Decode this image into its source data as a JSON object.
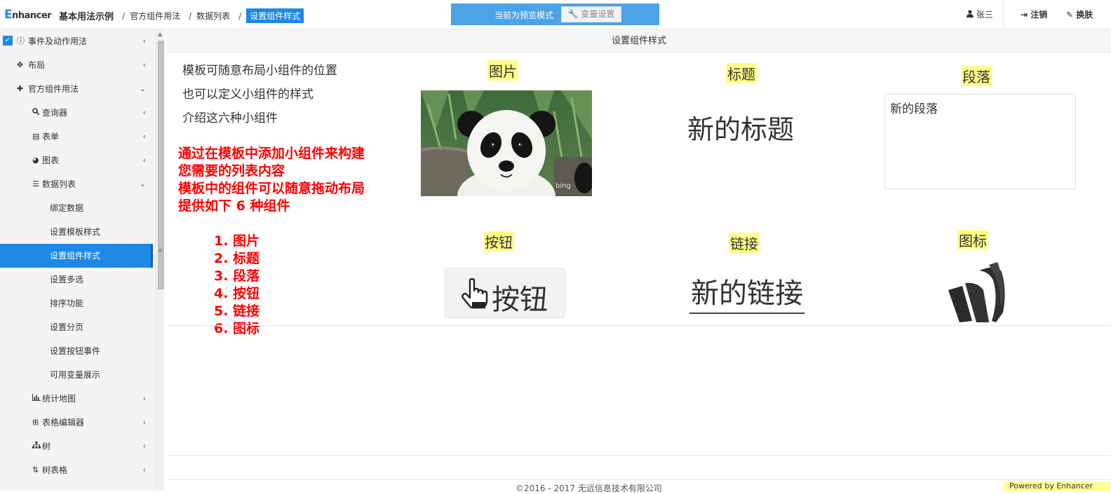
{
  "header": {
    "logo_initial": "E",
    "logo_rest": "nhancer",
    "breadcrumb": [
      "基本用法示例",
      "官方组件用法",
      "数据列表",
      "设置组件样式"
    ],
    "preview_text": "当前为预览模式",
    "variable_button": "变量设置",
    "user_name": "张三",
    "logout": "注销",
    "skin": "换肤"
  },
  "sidebar": {
    "items": [
      {
        "label": "事件及动作用法",
        "icon": "info-circle-icon",
        "arrow": "‹"
      },
      {
        "label": "布局",
        "icon": "move-icon",
        "arrow": "‹"
      },
      {
        "label": "官方组件用法",
        "icon": "puzzle-icon",
        "arrow": "⌄"
      },
      {
        "label": "查询器",
        "icon": "search-icon",
        "arrow": "‹"
      },
      {
        "label": "表单",
        "icon": "form-icon",
        "arrow": "‹"
      },
      {
        "label": "图表",
        "icon": "pie-chart-icon",
        "arrow": "‹"
      },
      {
        "label": "数据列表",
        "icon": "list-icon",
        "arrow": "⌄"
      },
      {
        "label": "绑定数据"
      },
      {
        "label": "设置模板样式"
      },
      {
        "label": "设置组件样式",
        "active": true
      },
      {
        "label": "设置多选"
      },
      {
        "label": "排序功能"
      },
      {
        "label": "设置分页"
      },
      {
        "label": "设置按钮事件"
      },
      {
        "label": "可用变量展示"
      },
      {
        "label": "统计地图",
        "icon": "bar-chart-icon",
        "arrow": "‹"
      },
      {
        "label": "表格编辑器",
        "icon": "table-icon",
        "arrow": "‹"
      },
      {
        "label": "树",
        "icon": "sitemap-icon",
        "arrow": "‹"
      },
      {
        "label": "树表格",
        "icon": "sort-icon",
        "arrow": "‹"
      }
    ],
    "collapse_glyph": "«"
  },
  "main": {
    "panel_title": "设置组件样式",
    "intro": [
      "模板可随意布局小组件的位置",
      "也可以定义小组件的样式",
      "介绍这六种小组件"
    ],
    "red_text": [
      "通过在模板中添加小组件来构建",
      "您需要的列表内容",
      "模板中的组件可以随意拖动布局",
      "提供如下 6 种组件"
    ],
    "red_list": [
      "1. 图片",
      "2. 标题",
      "3. 段落",
      "4. 按钮",
      "5. 链接",
      "6. 图标"
    ],
    "labels": {
      "image": "图片",
      "title": "标题",
      "paragraph": "段落",
      "button": "按钮",
      "link": "链接",
      "icon": "图标"
    },
    "sample_title": "新的标题",
    "sample_paragraph": "新的段落",
    "sample_button": "按钮",
    "sample_link": "新的链接",
    "panda_watermark": "bing"
  },
  "footer": {
    "copyright": "©2016 - 2017 无远信息技术有限公司",
    "powered": "Powered by Enhancer"
  },
  "colors": {
    "accent": "#1e88e5",
    "preview_bar": "#4da3e8",
    "highlight": "#ffff88",
    "red_note": "#ff0000"
  }
}
